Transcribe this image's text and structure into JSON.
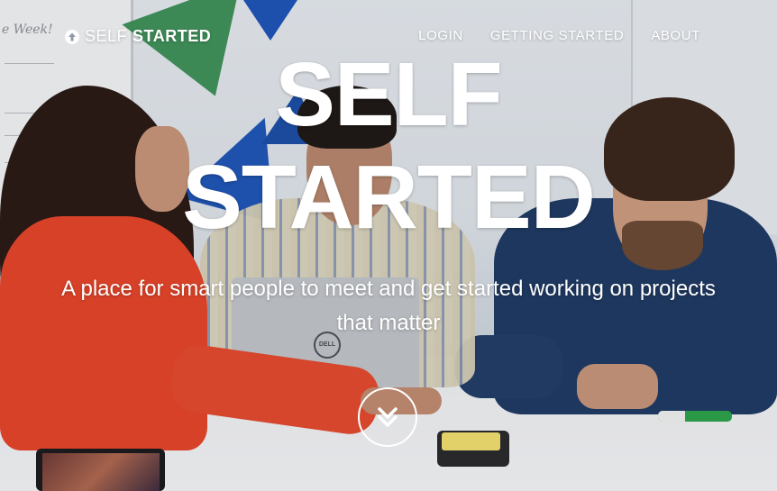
{
  "brand": {
    "icon": "arrow-up-circle-icon",
    "word1": "SELF",
    "word2": "STARTED"
  },
  "nav": {
    "items": [
      {
        "label": "LOGIN"
      },
      {
        "label": "GETTING STARTED"
      },
      {
        "label": "ABOUT"
      }
    ]
  },
  "hero": {
    "title_line1": "SELF",
    "title_line2": "STARTED",
    "tagline": "A place for smart people to meet and get started working on projects that matter",
    "scroll_icon": "chevron-double-down-icon"
  },
  "background": {
    "whiteboard_text": "e Week!",
    "laptop_brand": "DELL"
  },
  "colors": {
    "text": "#ffffff"
  }
}
